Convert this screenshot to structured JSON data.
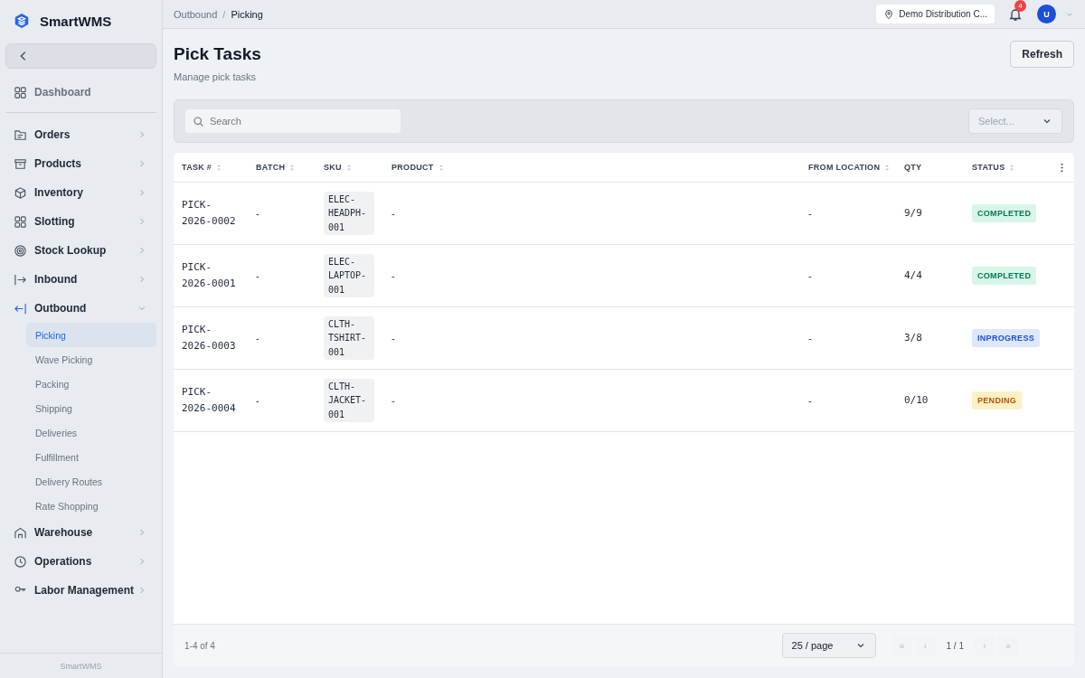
{
  "brand": {
    "name": "SmartWMS"
  },
  "sidebar": {
    "groups": [
      {
        "items": [
          {
            "label": "Dashboard",
            "expandable": false,
            "expanded": false
          }
        ]
      },
      {
        "items": [
          {
            "label": "Orders",
            "expandable": true,
            "expanded": false
          },
          {
            "label": "Products",
            "expandable": true,
            "expanded": false
          },
          {
            "label": "Inventory",
            "expandable": true,
            "expanded": false
          },
          {
            "label": "Slotting",
            "expandable": true,
            "expanded": false
          },
          {
            "label": "Stock Lookup",
            "expandable": true,
            "expanded": false
          },
          {
            "label": "Inbound",
            "expandable": true,
            "expanded": false
          },
          {
            "label": "Outbound",
            "expandable": true,
            "expanded": true,
            "children": [
              {
                "label": "Picking",
                "selected": true
              },
              {
                "label": "Wave Picking",
                "selected": false
              },
              {
                "label": "Packing",
                "selected": false
              },
              {
                "label": "Shipping",
                "selected": false
              },
              {
                "label": "Deliveries",
                "selected": false
              },
              {
                "label": "Fulfillment",
                "selected": false
              },
              {
                "label": "Delivery Routes",
                "selected": false
              },
              {
                "label": "Rate Shopping",
                "selected": false
              }
            ]
          },
          {
            "label": "Warehouse",
            "expandable": true,
            "expanded": false
          },
          {
            "label": "Operations",
            "expandable": true,
            "expanded": false
          },
          {
            "label": "Labor Management",
            "expandable": true,
            "expanded": false
          }
        ]
      }
    ],
    "footer": "SmartWMS"
  },
  "breadcrumb_separator": "/",
  "breadcrumb": [
    {
      "label": "Outbound",
      "current": false
    },
    {
      "label": "Picking",
      "current": true
    }
  ],
  "warehouse_selector": "Demo Distribution C...",
  "notifications": {
    "count": "4"
  },
  "user": {
    "initial": "U"
  },
  "page": {
    "title": "Pick Tasks",
    "subtitle": "Manage pick tasks",
    "refresh": "Refresh"
  },
  "filters": {
    "search_placeholder": "Search",
    "select_placeholder": "Select..."
  },
  "table": {
    "columns": [
      {
        "label": "TASK #",
        "sortable": true
      },
      {
        "label": "BATCH",
        "sortable": true
      },
      {
        "label": "SKU",
        "sortable": true
      },
      {
        "label": "PRODUCT",
        "sortable": true
      },
      {
        "label": "FROM LOCATION",
        "sortable": true
      },
      {
        "label": "QTY",
        "sortable": false
      },
      {
        "label": "STATUS",
        "sortable": true
      }
    ],
    "rows": [
      {
        "task": "PICK-2026-0002",
        "batch": "-",
        "sku": "ELEC-HEADPH-001",
        "product": "-",
        "from_location": "-",
        "qty": "9/9",
        "status": "COMPLETED",
        "kind": "completed"
      },
      {
        "task": "PICK-2026-0001",
        "batch": "-",
        "sku": "ELEC-LAPTOP-001",
        "product": "-",
        "from_location": "-",
        "qty": "4/4",
        "status": "COMPLETED",
        "kind": "completed"
      },
      {
        "task": "PICK-2026-0003",
        "batch": "-",
        "sku": "CLTH-TSHIRT-001",
        "product": "-",
        "from_location": "-",
        "qty": "3/8",
        "status": "INPROGRESS",
        "kind": "in_progress"
      },
      {
        "task": "PICK-2026-0004",
        "batch": "-",
        "sku": "CLTH-JACKET-001",
        "product": "-",
        "from_location": "-",
        "qty": "0/10",
        "status": "PENDING",
        "kind": "pending"
      }
    ]
  },
  "pagination": {
    "summary": "1-4 of 4",
    "page_size": "25 / page",
    "page": "1 / 1",
    "buttons": [
      {
        "label": "«",
        "disabled": true
      },
      {
        "label": "‹",
        "disabled": true
      },
      {
        "label": "›",
        "disabled": true
      },
      {
        "label": "»",
        "disabled": true
      }
    ]
  }
}
